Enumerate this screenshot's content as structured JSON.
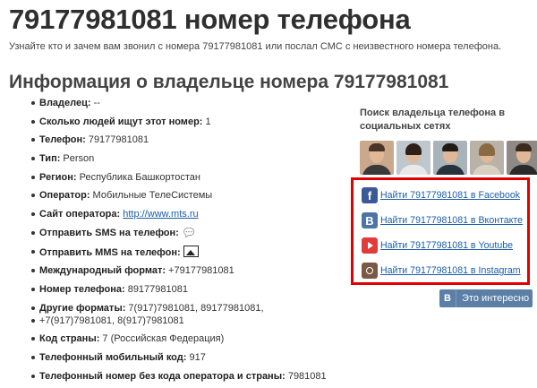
{
  "page": {
    "title": "79177981081 номер телефона",
    "intro": "Узнайте кто и зачем вам звонил с номера 79177981081 или послал СМС с неизвестного номера телефона.",
    "owner_heading": "Информация о владельце номера 79177981081"
  },
  "info": [
    {
      "label": "Владелец:",
      "value": " --"
    },
    {
      "label": "Сколько людей ищут этот номер:",
      "value": " 1"
    },
    {
      "label": "Телефон:",
      "value": " 79177981081"
    },
    {
      "label": "Тип:",
      "value": " Person"
    },
    {
      "label": "Регион:",
      "value": " Республика Башкортостан"
    },
    {
      "label": "Оператор:",
      "value": " Мобильные ТелеСистемы"
    },
    {
      "label": "Сайт оператора:",
      "link": "http://www.mts.ru"
    },
    {
      "label": "Отправить SMS на телефон:",
      "icon": "speech-bubble-icon"
    },
    {
      "label": "Отправить MMS на телефон:",
      "icon": "picture-icon"
    },
    {
      "label": "Международный формат:",
      "value": " +79177981081"
    },
    {
      "label": "Номер телефона:",
      "value": " 89177981081"
    },
    {
      "label": "Другие форматы:",
      "value": " 7(917)7981081, 89177981081,"
    },
    {
      "label": "",
      "value": "+7(917)7981081, 8(917)7981081"
    },
    {
      "label": "Код страны:",
      "value": " 7 (Российская Федерация)"
    },
    {
      "label": "Телефонный мобильный код:",
      "value": " 917"
    },
    {
      "label": "Телефонный номер без кода оператора и страны:",
      "value": " 7981081"
    }
  ],
  "sidebar": {
    "title": "Поиск владельца телефона в социальных сетях",
    "avatar_count": 5,
    "links": [
      {
        "icon": "facebook-icon",
        "color": "#3b5998",
        "text": "Найти 79177981081 в Facebook"
      },
      {
        "icon": "vkontakte-icon",
        "color": "#4c75a3",
        "text": "Найти 79177981081 в Вконтакте"
      },
      {
        "icon": "youtube-icon",
        "color": "#e13b3b",
        "text": "Найти 79177981081 в Youtube"
      },
      {
        "icon": "instagram-icon",
        "color": "#7a5a45",
        "text": "Найти 79177981081 в Instagram"
      }
    ],
    "highlight_color": "#e00000",
    "vk_button": {
      "logo": "B",
      "label": "Это интересно",
      "color": "#5b7fa6"
    }
  }
}
